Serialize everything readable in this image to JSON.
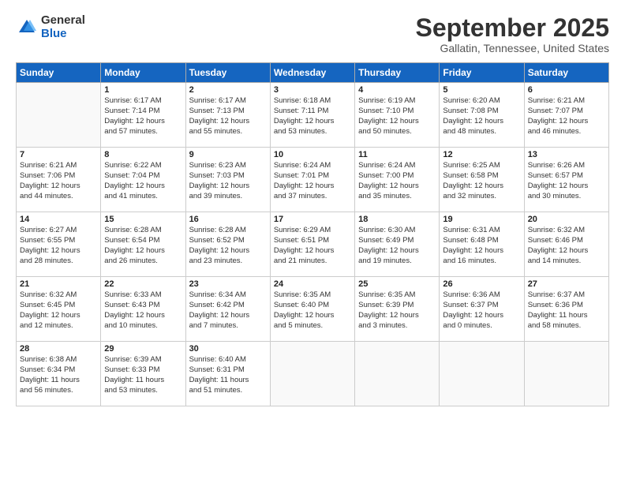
{
  "logo": {
    "general": "General",
    "blue": "Blue"
  },
  "title": "September 2025",
  "subtitle": "Gallatin, Tennessee, United States",
  "weekdays": [
    "Sunday",
    "Monday",
    "Tuesday",
    "Wednesday",
    "Thursday",
    "Friday",
    "Saturday"
  ],
  "weeks": [
    [
      {
        "day": "",
        "info": ""
      },
      {
        "day": "1",
        "info": "Sunrise: 6:17 AM\nSunset: 7:14 PM\nDaylight: 12 hours\nand 57 minutes."
      },
      {
        "day": "2",
        "info": "Sunrise: 6:17 AM\nSunset: 7:13 PM\nDaylight: 12 hours\nand 55 minutes."
      },
      {
        "day": "3",
        "info": "Sunrise: 6:18 AM\nSunset: 7:11 PM\nDaylight: 12 hours\nand 53 minutes."
      },
      {
        "day": "4",
        "info": "Sunrise: 6:19 AM\nSunset: 7:10 PM\nDaylight: 12 hours\nand 50 minutes."
      },
      {
        "day": "5",
        "info": "Sunrise: 6:20 AM\nSunset: 7:08 PM\nDaylight: 12 hours\nand 48 minutes."
      },
      {
        "day": "6",
        "info": "Sunrise: 6:21 AM\nSunset: 7:07 PM\nDaylight: 12 hours\nand 46 minutes."
      }
    ],
    [
      {
        "day": "7",
        "info": "Sunrise: 6:21 AM\nSunset: 7:06 PM\nDaylight: 12 hours\nand 44 minutes."
      },
      {
        "day": "8",
        "info": "Sunrise: 6:22 AM\nSunset: 7:04 PM\nDaylight: 12 hours\nand 41 minutes."
      },
      {
        "day": "9",
        "info": "Sunrise: 6:23 AM\nSunset: 7:03 PM\nDaylight: 12 hours\nand 39 minutes."
      },
      {
        "day": "10",
        "info": "Sunrise: 6:24 AM\nSunset: 7:01 PM\nDaylight: 12 hours\nand 37 minutes."
      },
      {
        "day": "11",
        "info": "Sunrise: 6:24 AM\nSunset: 7:00 PM\nDaylight: 12 hours\nand 35 minutes."
      },
      {
        "day": "12",
        "info": "Sunrise: 6:25 AM\nSunset: 6:58 PM\nDaylight: 12 hours\nand 32 minutes."
      },
      {
        "day": "13",
        "info": "Sunrise: 6:26 AM\nSunset: 6:57 PM\nDaylight: 12 hours\nand 30 minutes."
      }
    ],
    [
      {
        "day": "14",
        "info": "Sunrise: 6:27 AM\nSunset: 6:55 PM\nDaylight: 12 hours\nand 28 minutes."
      },
      {
        "day": "15",
        "info": "Sunrise: 6:28 AM\nSunset: 6:54 PM\nDaylight: 12 hours\nand 26 minutes."
      },
      {
        "day": "16",
        "info": "Sunrise: 6:28 AM\nSunset: 6:52 PM\nDaylight: 12 hours\nand 23 minutes."
      },
      {
        "day": "17",
        "info": "Sunrise: 6:29 AM\nSunset: 6:51 PM\nDaylight: 12 hours\nand 21 minutes."
      },
      {
        "day": "18",
        "info": "Sunrise: 6:30 AM\nSunset: 6:49 PM\nDaylight: 12 hours\nand 19 minutes."
      },
      {
        "day": "19",
        "info": "Sunrise: 6:31 AM\nSunset: 6:48 PM\nDaylight: 12 hours\nand 16 minutes."
      },
      {
        "day": "20",
        "info": "Sunrise: 6:32 AM\nSunset: 6:46 PM\nDaylight: 12 hours\nand 14 minutes."
      }
    ],
    [
      {
        "day": "21",
        "info": "Sunrise: 6:32 AM\nSunset: 6:45 PM\nDaylight: 12 hours\nand 12 minutes."
      },
      {
        "day": "22",
        "info": "Sunrise: 6:33 AM\nSunset: 6:43 PM\nDaylight: 12 hours\nand 10 minutes."
      },
      {
        "day": "23",
        "info": "Sunrise: 6:34 AM\nSunset: 6:42 PM\nDaylight: 12 hours\nand 7 minutes."
      },
      {
        "day": "24",
        "info": "Sunrise: 6:35 AM\nSunset: 6:40 PM\nDaylight: 12 hours\nand 5 minutes."
      },
      {
        "day": "25",
        "info": "Sunrise: 6:35 AM\nSunset: 6:39 PM\nDaylight: 12 hours\nand 3 minutes."
      },
      {
        "day": "26",
        "info": "Sunrise: 6:36 AM\nSunset: 6:37 PM\nDaylight: 12 hours\nand 0 minutes."
      },
      {
        "day": "27",
        "info": "Sunrise: 6:37 AM\nSunset: 6:36 PM\nDaylight: 11 hours\nand 58 minutes."
      }
    ],
    [
      {
        "day": "28",
        "info": "Sunrise: 6:38 AM\nSunset: 6:34 PM\nDaylight: 11 hours\nand 56 minutes."
      },
      {
        "day": "29",
        "info": "Sunrise: 6:39 AM\nSunset: 6:33 PM\nDaylight: 11 hours\nand 53 minutes."
      },
      {
        "day": "30",
        "info": "Sunrise: 6:40 AM\nSunset: 6:31 PM\nDaylight: 11 hours\nand 51 minutes."
      },
      {
        "day": "",
        "info": ""
      },
      {
        "day": "",
        "info": ""
      },
      {
        "day": "",
        "info": ""
      },
      {
        "day": "",
        "info": ""
      }
    ]
  ]
}
